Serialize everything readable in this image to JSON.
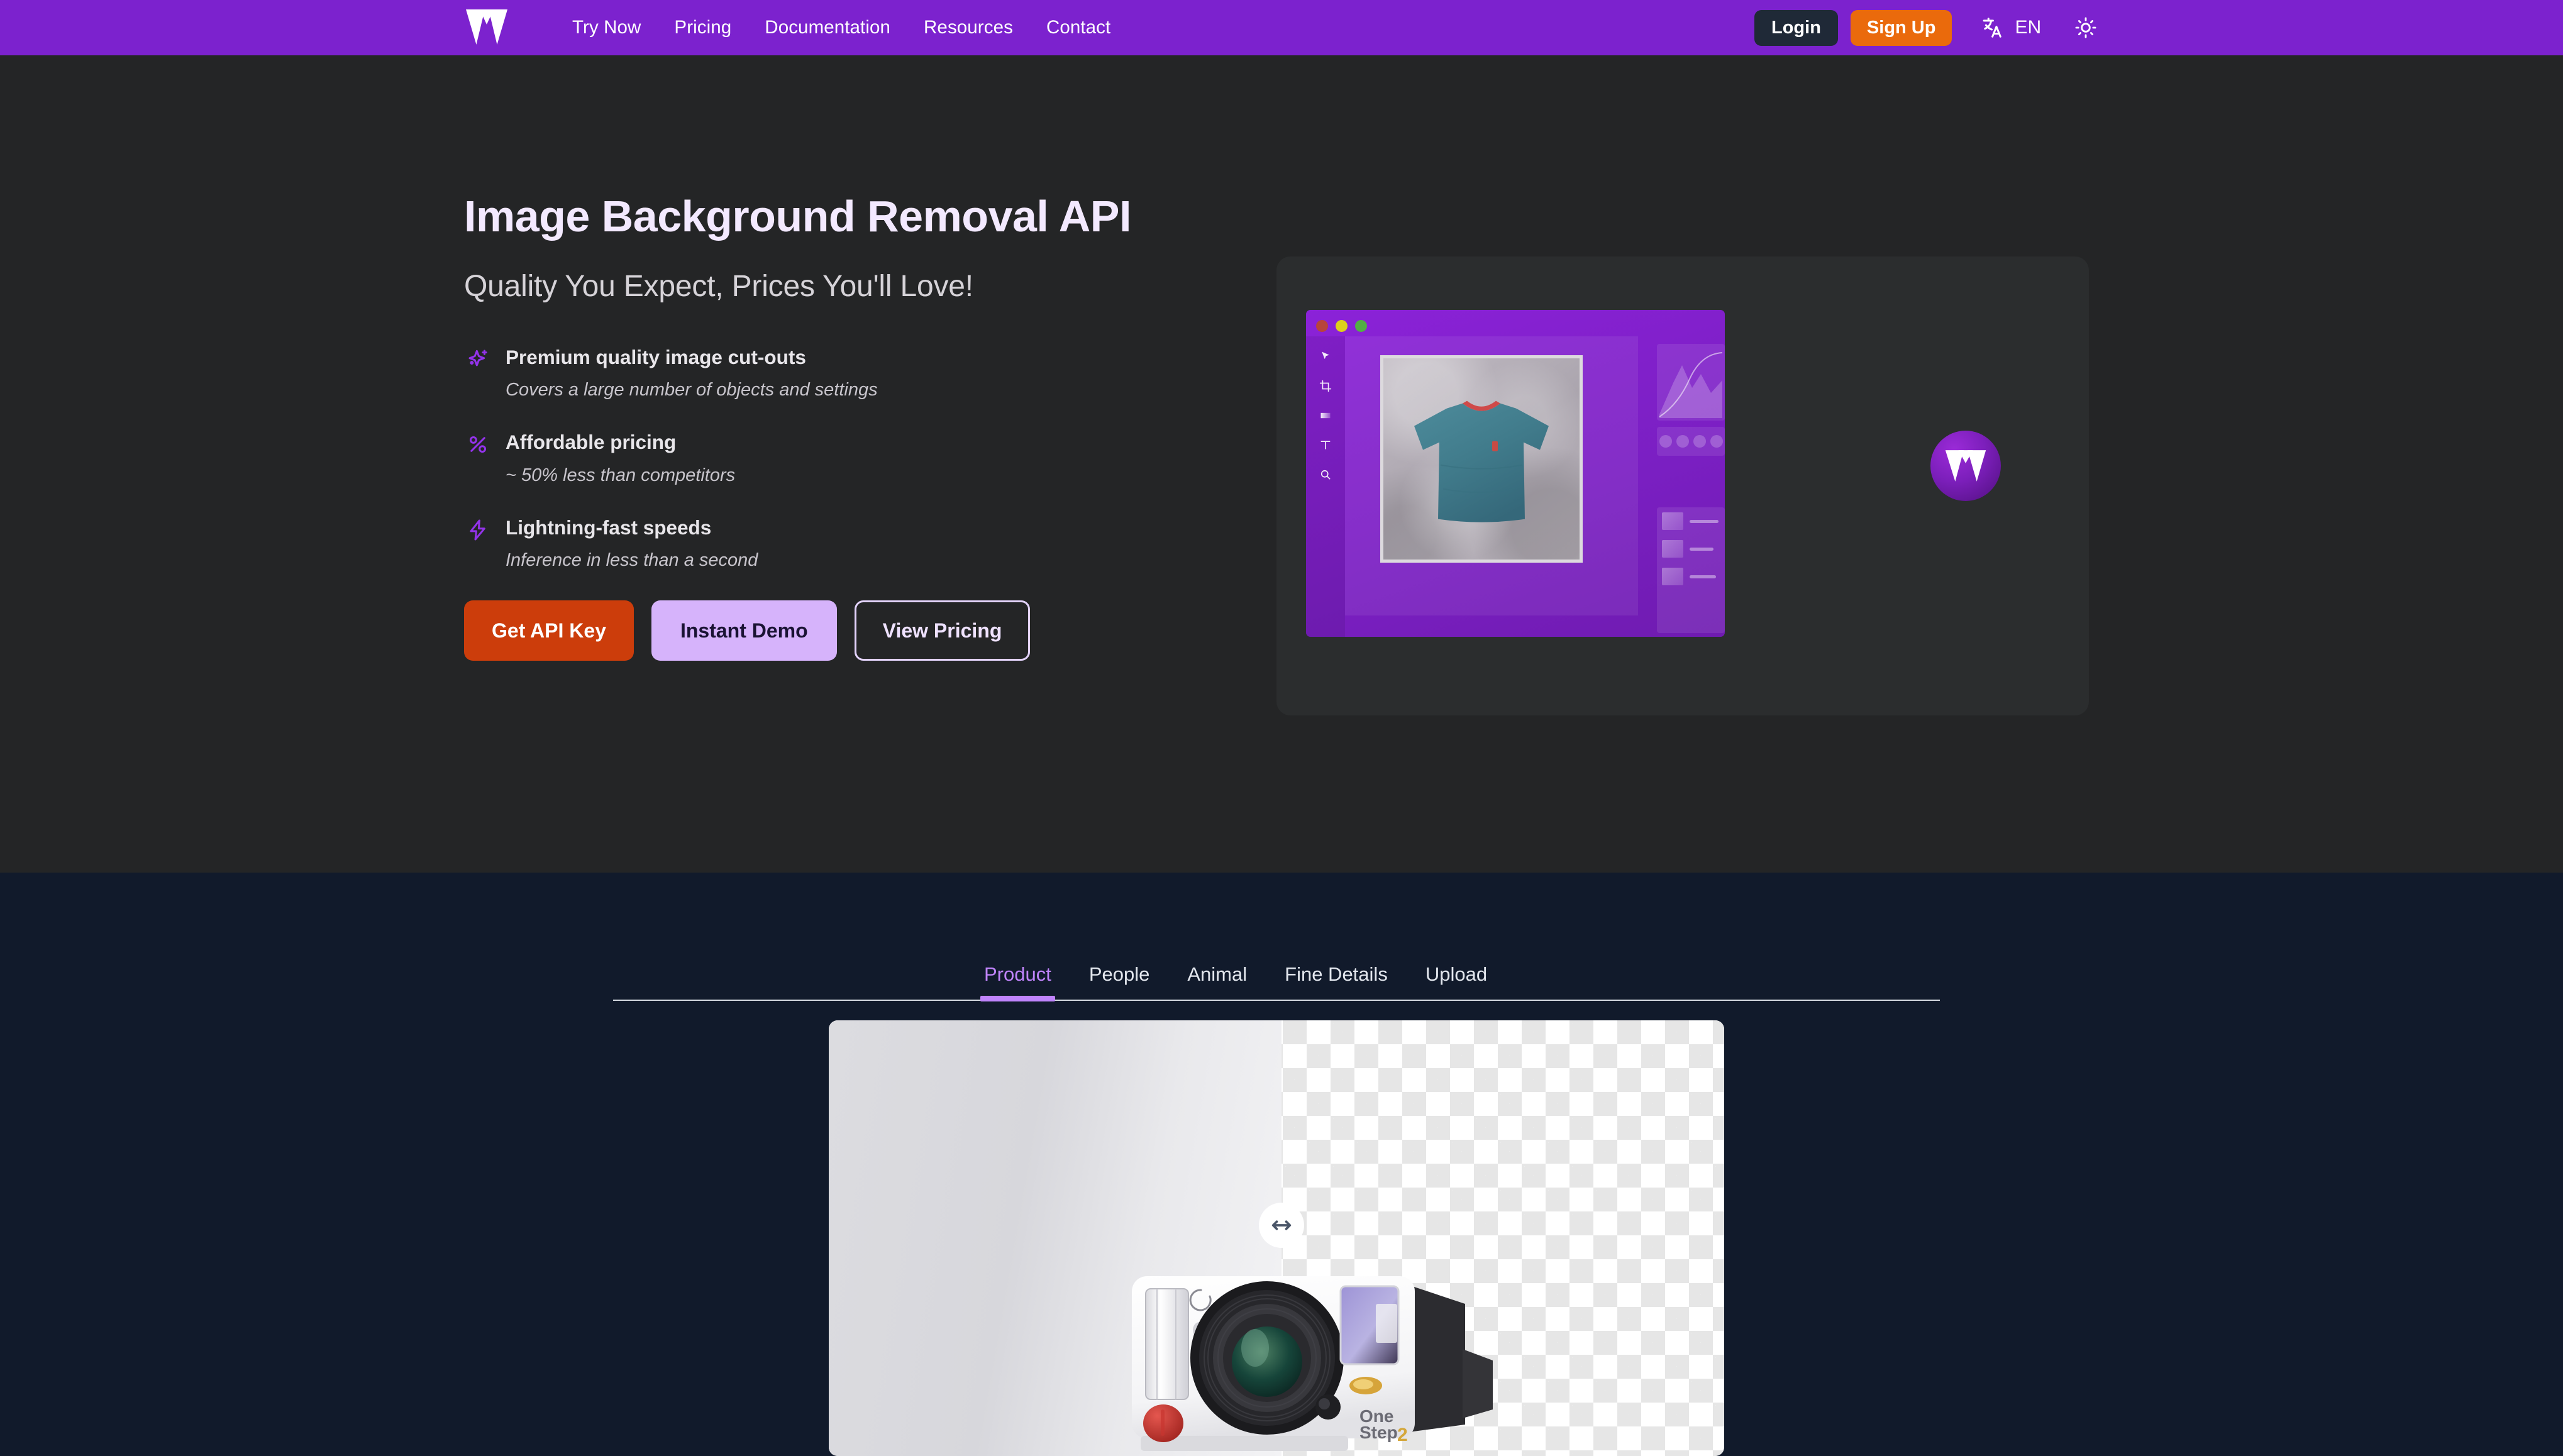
{
  "brand": {
    "logo_name": "withoutbg-logo",
    "mark": "W"
  },
  "nav": {
    "links": [
      {
        "label": "Try Now"
      },
      {
        "label": "Pricing"
      },
      {
        "label": "Documentation"
      },
      {
        "label": "Resources"
      },
      {
        "label": "Contact"
      }
    ],
    "login_label": "Login",
    "signup_label": "Sign Up",
    "language_code": "EN",
    "language_icon": "translate-icon",
    "theme_icon": "sun-icon"
  },
  "hero": {
    "title": "Image Background Removal API",
    "subtitle": "Quality You Expect, Prices You'll Love!",
    "features": [
      {
        "icon": "sparkles-icon",
        "title": "Premium quality image cut-outs",
        "desc": "Covers a large number of objects and settings"
      },
      {
        "icon": "percent-icon",
        "title": "Affordable pricing",
        "desc": "~ 50% less than competitors"
      },
      {
        "icon": "lightning-bolt-icon",
        "title": "Lightning-fast speeds",
        "desc": "Inference in less than a second"
      }
    ],
    "cta": {
      "primary": "Get API Key",
      "secondary": "Instant Demo",
      "outline": "View Pricing"
    },
    "illustration": {
      "window_title": "mock-image-editor",
      "tools": [
        "cursor-icon",
        "crop-icon",
        "layers-icon",
        "text-icon",
        "search-icon"
      ],
      "canvas_subject": "teal t-shirt on concrete background",
      "side_panel_icons": [
        "pause-icon",
        "droplet-icon",
        "gear-icon",
        "trend-icon"
      ],
      "side_panel_rows": 3
    }
  },
  "demo": {
    "tabs": [
      {
        "label": "Product",
        "active": true
      },
      {
        "label": "People",
        "active": false
      },
      {
        "label": "Animal",
        "active": false
      },
      {
        "label": "Fine Details",
        "active": false
      },
      {
        "label": "Upload",
        "active": false
      }
    ],
    "comparison": {
      "subject": "Polaroid OneStep 2 instant camera",
      "brand_text_line1": "One",
      "brand_text_line2": "Step",
      "brand_text_suffix": "2",
      "before_label": "original photo with gray studio backdrop",
      "after_label": "transparent checkerboard background",
      "handle_icon": "horizontal-resize-arrow-icon",
      "split_position_percent": 50
    }
  },
  "colors": {
    "brand_purple": "#7c22ce",
    "accent_orange": "#ea6a0c",
    "cta_orange": "#cc3d0b",
    "cta_lavender": "#d6b3fb",
    "tab_active": "#c084fc",
    "hero_bg": "#242526",
    "demo_bg": "#111a2b",
    "icon_purple": "#9333ea"
  }
}
